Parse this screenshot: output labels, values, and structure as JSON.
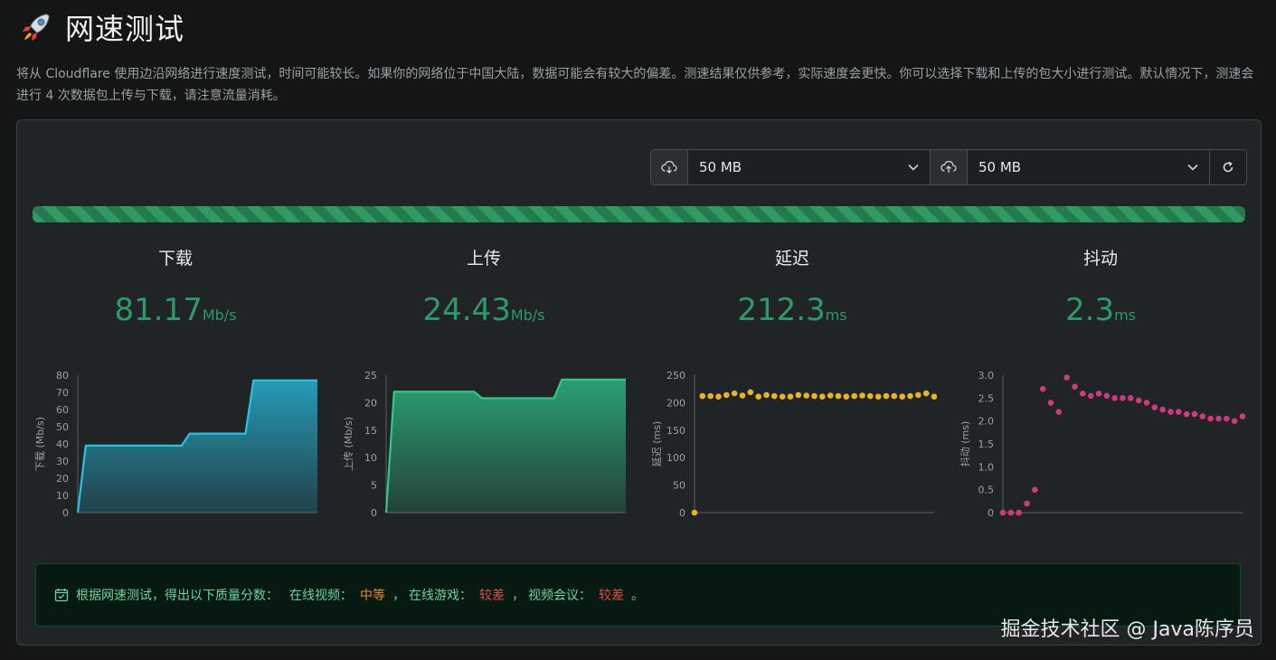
{
  "header": {
    "title": "网速测试",
    "description": "将从 Cloudflare 使用边沿网络进行速度测试，时间可能较长。如果你的网络位于中国大陆，数据可能会有较大的偏差。测速结果仅供参考，实际速度会更快。你可以选择下载和上传的包大小进行测试。默认情况下，测速会进行 4 次数据包上传与下载，请注意流量消耗。"
  },
  "controls": {
    "download_size": "50 MB",
    "upload_size": "50 MB"
  },
  "progress": {
    "percent": 100
  },
  "stats": [
    {
      "label": "下载",
      "value": "81.17",
      "unit": "Mb/s"
    },
    {
      "label": "上传",
      "value": "24.43",
      "unit": "Mb/s"
    },
    {
      "label": "延迟",
      "value": "212.3",
      "unit": "ms"
    },
    {
      "label": "抖动",
      "value": "2.3",
      "unit": "ms"
    }
  ],
  "colors": {
    "download": "#27c3e6",
    "upload": "#2ec98a",
    "latency": "#e9b422",
    "jitter": "#cc3b7d",
    "value_green": "#2e9a6a"
  },
  "chart_data": [
    {
      "type": "area",
      "ylabel": "下载 (Mb/s)",
      "ylim": [
        0,
        80
      ],
      "yticks": [
        "0",
        "10",
        "20",
        "30",
        "40",
        "50",
        "60",
        "70",
        "80"
      ],
      "x": [
        0,
        1,
        2,
        3,
        4,
        5,
        6,
        7,
        8,
        9,
        10,
        11,
        12,
        13,
        14,
        15,
        16,
        17,
        18,
        19,
        20,
        21,
        22,
        23,
        24,
        25,
        26,
        27,
        28,
        29,
        30
      ],
      "values": [
        0,
        39,
        39,
        39,
        39,
        39,
        39,
        39,
        39,
        39,
        39,
        39,
        39,
        39,
        46,
        46,
        46,
        46,
        46,
        46,
        46,
        46,
        77,
        77,
        77,
        77,
        77,
        77,
        77,
        77,
        77
      ]
    },
    {
      "type": "area",
      "ylabel": "上传 (Mb/s)",
      "ylim": [
        0,
        25
      ],
      "yticks": [
        "0",
        "5",
        "10",
        "15",
        "20",
        "25"
      ],
      "x": [
        0,
        1,
        2,
        3,
        4,
        5,
        6,
        7,
        8,
        9,
        10,
        11,
        12,
        13,
        14,
        15,
        16,
        17,
        18,
        19,
        20,
        21,
        22,
        23,
        24,
        25,
        26,
        27,
        28,
        29,
        30
      ],
      "values": [
        0,
        22,
        22,
        22,
        22,
        22,
        22,
        22,
        22,
        22,
        22,
        22,
        20.8,
        20.8,
        20.8,
        20.8,
        20.8,
        20.8,
        20.8,
        20.8,
        20.8,
        20.8,
        24.2,
        24.2,
        24.2,
        24.2,
        24.2,
        24.2,
        24.2,
        24.2,
        24.2
      ]
    },
    {
      "type": "scatter",
      "ylabel": "延迟 (ms)",
      "ylim": [
        0,
        250
      ],
      "yticks": [
        "0",
        "50",
        "100",
        "150",
        "200",
        "250"
      ],
      "x": [
        0,
        1,
        2,
        3,
        4,
        5,
        6,
        7,
        8,
        9,
        10,
        11,
        12,
        13,
        14,
        15,
        16,
        17,
        18,
        19,
        20,
        21,
        22,
        23,
        24,
        25,
        26,
        27,
        28,
        29,
        30
      ],
      "values": [
        0,
        212,
        212,
        211,
        214,
        217,
        213,
        219,
        211,
        214,
        212,
        211,
        211,
        214,
        213,
        212,
        211,
        213,
        212,
        211,
        212,
        213,
        212,
        211,
        212,
        212,
        211,
        212,
        214,
        217,
        211
      ]
    },
    {
      "type": "scatter",
      "ylabel": "抖动 (ms)",
      "ylim": [
        0,
        3
      ],
      "yticks": [
        "0",
        "0.5",
        "1.0",
        "1.5",
        "2.0",
        "2.5",
        "3.0"
      ],
      "x": [
        0,
        1,
        2,
        3,
        4,
        5,
        6,
        7,
        8,
        9,
        10,
        11,
        12,
        13,
        14,
        15,
        16,
        17,
        18,
        19,
        20,
        21,
        22,
        23,
        24,
        25,
        26,
        27,
        28,
        29,
        30
      ],
      "values": [
        0,
        0,
        0,
        0.2,
        0.5,
        2.7,
        2.4,
        2.2,
        2.95,
        2.75,
        2.6,
        2.55,
        2.6,
        2.55,
        2.5,
        2.5,
        2.5,
        2.45,
        2.4,
        2.3,
        2.25,
        2.2,
        2.2,
        2.15,
        2.15,
        2.1,
        2.05,
        2.05,
        2.05,
        2.0,
        2.1
      ]
    }
  ],
  "result": {
    "intro": "根据网速测试，得出以下质量分数：",
    "video_label": "在线视频：",
    "video_value": "中等",
    "sep1": "，",
    "game_label": "在线游戏：",
    "game_value": "较差",
    "sep2": "，",
    "meeting_label": "视频会议：",
    "meeting_value": "较差",
    "end": "。"
  },
  "watermark": "掘金技术社区 @ Java陈序员"
}
